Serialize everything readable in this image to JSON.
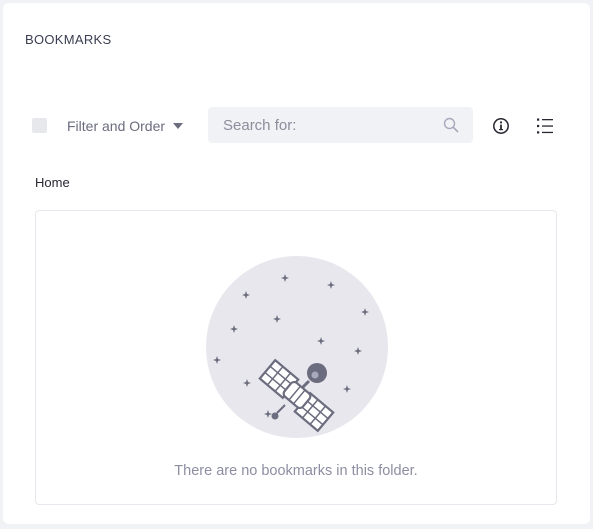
{
  "panel": {
    "title": "BOOKMARKS"
  },
  "toolbar": {
    "filter_label": "Filter and Order",
    "search_placeholder": "Search for:",
    "search_value": ""
  },
  "icons": {
    "search": "search-icon",
    "info": "info-circle-icon",
    "list": "list-view-icon",
    "caret": "caret-down-icon",
    "illustration": "satellite-illustration"
  },
  "breadcrumb": {
    "current": "Home"
  },
  "empty_state": {
    "message": "There are no bookmarks in this folder."
  },
  "colors": {
    "panel_bg": "#ffffff",
    "page_bg": "#f1f2f5",
    "text_secondary": "#6b6c7e",
    "illustration_bg": "#e7e7ed"
  }
}
